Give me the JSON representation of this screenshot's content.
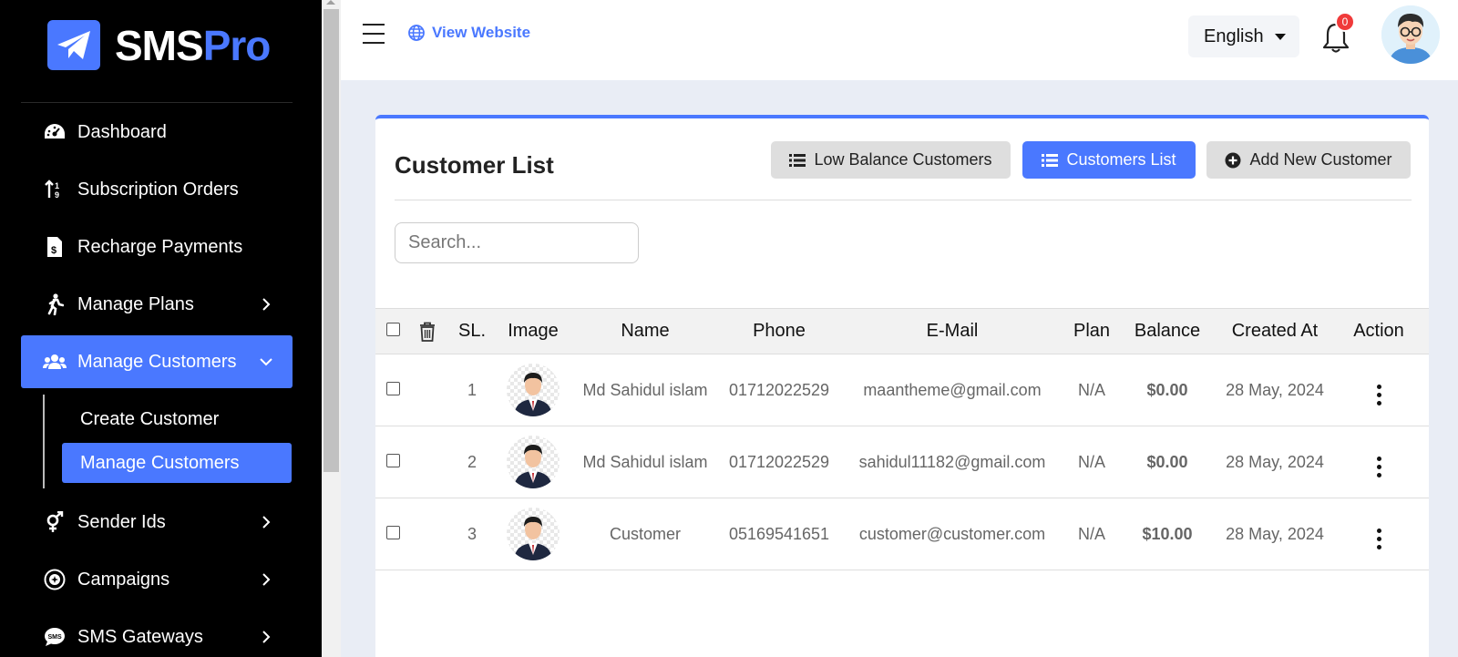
{
  "brand": {
    "name_part1": "SMS",
    "name_part2": "Pro",
    "color": "#4a78ff"
  },
  "sidebar": {
    "items": [
      {
        "label": "Dashboard",
        "icon": "dashboard-gauge-icon"
      },
      {
        "label": "Subscription Orders",
        "icon": "sort-arrows-icon"
      },
      {
        "label": "Recharge Payments",
        "icon": "invoice-dollar-icon"
      },
      {
        "label": "Manage Plans",
        "icon": "running-person-icon",
        "has_children": true
      },
      {
        "label": "Manage Customers",
        "icon": "users-icon",
        "has_children": true,
        "expanded": true,
        "active": true
      },
      {
        "label": "Sender Ids",
        "icon": "mars-venus-icon",
        "has_children": true
      },
      {
        "label": "Campaigns",
        "icon": "campaign-badge-icon",
        "has_children": true
      },
      {
        "label": "SMS Gateways",
        "icon": "sms-bubble-icon",
        "has_children": true
      }
    ],
    "subitems": [
      {
        "label": "Create Customer"
      },
      {
        "label": "Manage Customers",
        "active": true
      }
    ]
  },
  "header": {
    "view_website": "View Website",
    "language": "English",
    "notification_count": "0"
  },
  "card": {
    "title": "Customer List",
    "buttons": {
      "low_balance": "Low Balance Customers",
      "customers_list": "Customers List",
      "add_new": "Add New Customer"
    },
    "search_placeholder": "Search..."
  },
  "table": {
    "columns": [
      "SL.",
      "Image",
      "Name",
      "Phone",
      "E-Mail",
      "Plan",
      "Balance",
      "Created At",
      "Action"
    ],
    "rows": [
      {
        "sl": "1",
        "name": "Md Sahidul islam",
        "phone": "01712022529",
        "email": "maantheme@gmail.com",
        "plan": "N/A",
        "balance": "$0.00",
        "balance_status": "zero",
        "created_at": "28 May, 2024"
      },
      {
        "sl": "2",
        "name": "Md Sahidul islam",
        "phone": "01712022529",
        "email": "sahidul11182@gmail.com",
        "plan": "N/A",
        "balance": "$0.00",
        "balance_status": "zero",
        "created_at": "28 May, 2024"
      },
      {
        "sl": "3",
        "name": "Customer",
        "phone": "05169541651",
        "email": "customer@customer.com",
        "plan": "N/A",
        "balance": "$10.00",
        "balance_status": "positive",
        "created_at": "28 May, 2024"
      }
    ]
  },
  "colors": {
    "accent": "#4a78ff",
    "negative": "#dc2f3c",
    "positive": "#17a74a",
    "sidebar_bg": "#000000"
  }
}
